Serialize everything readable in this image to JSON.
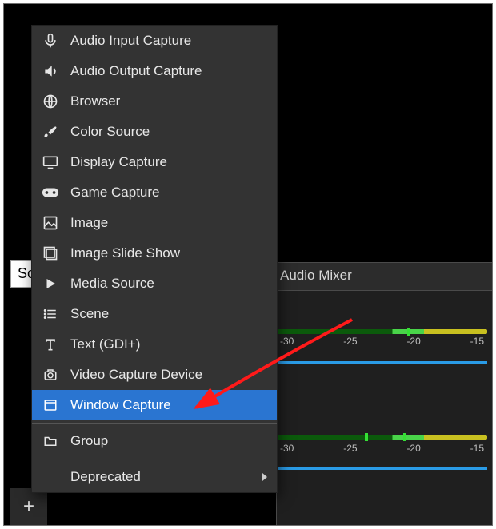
{
  "sources_tab_text": "So",
  "plus_glyph": "+",
  "mixer": {
    "title": "Audio Mixer",
    "ticks": [
      "-30",
      "-25",
      "-20",
      "-15"
    ]
  },
  "menu": {
    "items": [
      {
        "icon": "mic-icon",
        "label_key": "mi0",
        "label": "Audio Input Capture"
      },
      {
        "icon": "speaker-icon",
        "label_key": "mi1",
        "label": "Audio Output Capture"
      },
      {
        "icon": "globe-icon",
        "label_key": "mi2",
        "label": "Browser"
      },
      {
        "icon": "brush-icon",
        "label_key": "mi3",
        "label": "Color Source"
      },
      {
        "icon": "monitor-icon",
        "label_key": "mi4",
        "label": "Display Capture"
      },
      {
        "icon": "gamepad-icon",
        "label_key": "mi5",
        "label": "Game Capture"
      },
      {
        "icon": "image-icon",
        "label_key": "mi6",
        "label": "Image"
      },
      {
        "icon": "slideshow-icon",
        "label_key": "mi7",
        "label": "Image Slide Show"
      },
      {
        "icon": "play-icon",
        "label_key": "mi8",
        "label": "Media Source"
      },
      {
        "icon": "list-icon",
        "label_key": "mi9",
        "label": "Scene"
      },
      {
        "icon": "text-icon",
        "label_key": "mi10",
        "label": "Text (GDI+)"
      },
      {
        "icon": "camera-icon",
        "label_key": "mi11",
        "label": "Video Capture Device"
      },
      {
        "icon": "window-icon",
        "label_key": "mi12",
        "label": "Window Capture",
        "selected": true
      }
    ],
    "group": {
      "icon": "folder-icon",
      "label": "Group"
    },
    "deprecated": {
      "label": "Deprecated",
      "has_submenu": true
    }
  }
}
